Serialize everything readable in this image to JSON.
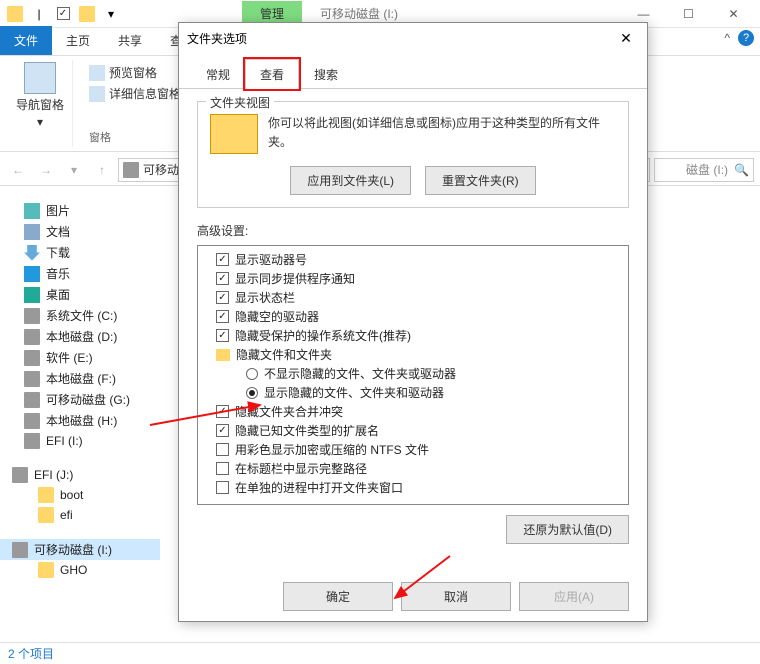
{
  "titlebar": {
    "ctx_tab": "管理",
    "drive_tab": "可移动磁盘 (I:)"
  },
  "ribbon": {
    "file": "文件",
    "tabs": [
      "主页",
      "共享",
      "查"
    ],
    "nav_panel": "导航窗格",
    "preview": "预览窗格",
    "details": "详细信息窗格",
    "group": "窗格"
  },
  "help": {
    "expand": "^"
  },
  "nav": {
    "addr_label": "可移动",
    "search_placeholder": "磁盘 (I:)"
  },
  "tree": [
    {
      "icon": "pic",
      "label": "图片"
    },
    {
      "icon": "doc",
      "label": "文档"
    },
    {
      "icon": "down",
      "label": "下载"
    },
    {
      "icon": "music",
      "label": "音乐"
    },
    {
      "icon": "desk",
      "label": "桌面"
    },
    {
      "icon": "drive",
      "label": "系统文件 (C:)"
    },
    {
      "icon": "drive",
      "label": "本地磁盘 (D:)"
    },
    {
      "icon": "drive",
      "label": "软件 (E:)"
    },
    {
      "icon": "drive",
      "label": "本地磁盘 (F:)"
    },
    {
      "icon": "drive",
      "label": "可移动磁盘 (G:)"
    },
    {
      "icon": "drive",
      "label": "本地磁盘 (H:)"
    },
    {
      "icon": "drive",
      "label": "EFI (I:)"
    }
  ],
  "tree2_header": "EFI (J:)",
  "tree2": [
    {
      "icon": "folder",
      "label": "boot"
    },
    {
      "icon": "folder",
      "label": "efi"
    }
  ],
  "tree3_header": "可移动磁盘 (I:)",
  "tree3": [
    {
      "icon": "folder",
      "label": "GHO"
    }
  ],
  "status": "2 个项目",
  "dialog": {
    "title": "文件夹选项",
    "tabs": {
      "general": "常规",
      "view": "查看",
      "search": "搜索"
    },
    "group_legend": "文件夹视图",
    "group_desc": "你可以将此视图(如详细信息或图标)应用于这种类型的所有文件夹。",
    "apply_folders": "应用到文件夹(L)",
    "reset_folders": "重置文件夹(R)",
    "advanced_label": "高级设置:",
    "items": [
      {
        "t": "chk",
        "on": true,
        "label": "显示驱动器号"
      },
      {
        "t": "chk",
        "on": true,
        "label": "显示同步提供程序通知"
      },
      {
        "t": "chk",
        "on": true,
        "label": "显示状态栏"
      },
      {
        "t": "chk",
        "on": true,
        "label": "隐藏空的驱动器"
      },
      {
        "t": "chk",
        "on": true,
        "label": "隐藏受保护的操作系统文件(推荐)"
      },
      {
        "t": "hdr",
        "label": "隐藏文件和文件夹"
      },
      {
        "t": "rad",
        "on": false,
        "label": "不显示隐藏的文件、文件夹或驱动器"
      },
      {
        "t": "rad",
        "on": true,
        "label": "显示隐藏的文件、文件夹和驱动器"
      },
      {
        "t": "chk",
        "on": true,
        "label": "隐藏文件夹合并冲突"
      },
      {
        "t": "chk",
        "on": true,
        "label": "隐藏已知文件类型的扩展名"
      },
      {
        "t": "chk",
        "on": false,
        "label": "用彩色显示加密或压缩的 NTFS 文件"
      },
      {
        "t": "chk",
        "on": false,
        "label": "在标题栏中显示完整路径"
      },
      {
        "t": "chk",
        "on": false,
        "label": "在单独的进程中打开文件夹窗口"
      }
    ],
    "restore": "还原为默认值(D)",
    "ok": "确定",
    "cancel": "取消",
    "apply": "应用(A)"
  }
}
